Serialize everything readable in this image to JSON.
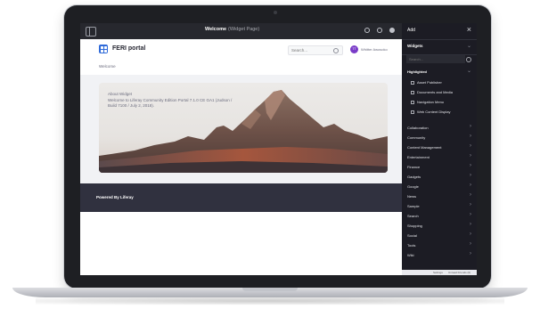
{
  "control_bar": {
    "title": "Welcome",
    "subtitle": "(Widget Page)"
  },
  "site": {
    "name": "FERI portal"
  },
  "search": {
    "placeholder": "Search..."
  },
  "user": {
    "initials": "TT",
    "name": "Whitter Awosoko"
  },
  "breadcrumb": "Welcome",
  "hero": {
    "title": "About Widget",
    "text": "Welcome to Liferay Community Edition Portal 7.1.0 CE GA1 (Judson / Build 7100 / July 2, 2018)."
  },
  "footer": {
    "text": "Powered By Liferay"
  },
  "panel": {
    "title": "Add",
    "close": "×",
    "widgets_label": "Widgets",
    "search_placeholder": "Search...",
    "highlighted_label": "Highlighted",
    "highlighted": [
      "Asset Publisher",
      "Documents and Media",
      "Navigation Menu",
      "Web Content Display"
    ],
    "categories": [
      "Collaboration",
      "Community",
      "Content Management",
      "Entertainment",
      "Finance",
      "Gadgets",
      "Google",
      "News",
      "Sample",
      "Search",
      "Shopping",
      "Social",
      "Tools",
      "Wiki"
    ],
    "bottom_left": "Settings",
    "bottom_right": "Unread Friends (0)"
  }
}
